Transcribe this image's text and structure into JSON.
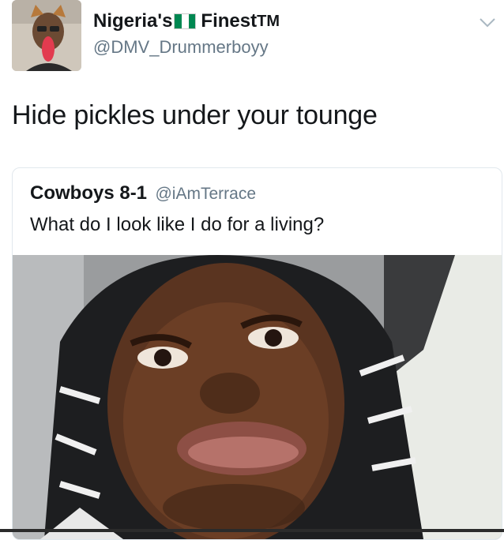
{
  "tweet": {
    "display_name_part1": "Nigeria's",
    "display_name_part2": "Finest",
    "display_name_suffix": "TM",
    "handle": "@DMV_Drummerboyy",
    "text": "Hide pickles under your tounge"
  },
  "quoted_tweet": {
    "display_name": "Cowboys 8-1",
    "handle": "@iAmTerrace",
    "text": "What do I look like I do for a living?"
  },
  "colors": {
    "text_primary": "#14171a",
    "text_secondary": "#657786",
    "border": "#e1e8ed",
    "flag_green": "#008751",
    "flag_white": "#ffffff"
  },
  "icons": {
    "menu": "chevron-down-icon"
  }
}
